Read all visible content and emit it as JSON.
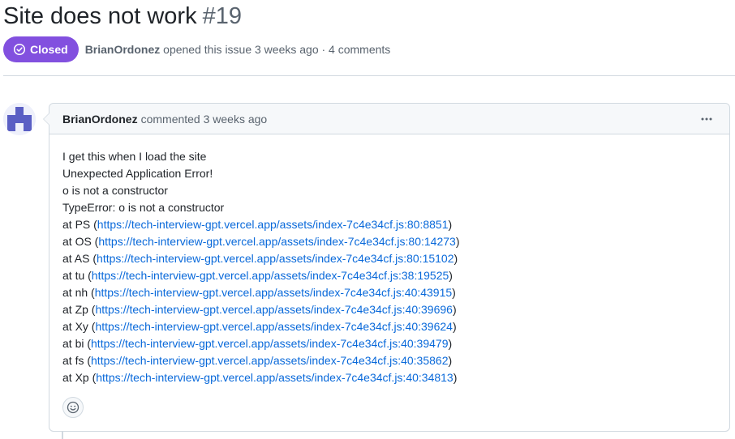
{
  "issue": {
    "title": "Site does not work",
    "number": "#19",
    "state": "Closed",
    "state_color": "#8250df",
    "author": "BrianOrdonez",
    "meta_suffix": "opened this issue 3 weeks ago · 4 comments"
  },
  "comment": {
    "author": "BrianOrdonez",
    "action": "commented 3 weeks ago",
    "menu_icon": "kebab-horizontal-icon",
    "intro_lines": [
      "I get this when I load the site",
      "Unexpected Application Error!",
      "o is not a constructor",
      "TypeError: o is not a constructor"
    ],
    "stack_frames": [
      {
        "prefix": "at PS (",
        "url": "https://tech-interview-gpt.vercel.app/assets/index-7c4e34cf.js:80:8851",
        "suffix": ")"
      },
      {
        "prefix": "at OS (",
        "url": "https://tech-interview-gpt.vercel.app/assets/index-7c4e34cf.js:80:14273",
        "suffix": ")"
      },
      {
        "prefix": "at AS (",
        "url": "https://tech-interview-gpt.vercel.app/assets/index-7c4e34cf.js:80:15102",
        "suffix": ")"
      },
      {
        "prefix": "at tu (",
        "url": "https://tech-interview-gpt.vercel.app/assets/index-7c4e34cf.js:38:19525",
        "suffix": ")"
      },
      {
        "prefix": "at nh (",
        "url": "https://tech-interview-gpt.vercel.app/assets/index-7c4e34cf.js:40:43915",
        "suffix": ")"
      },
      {
        "prefix": "at Zp (",
        "url": "https://tech-interview-gpt.vercel.app/assets/index-7c4e34cf.js:40:39696",
        "suffix": ")"
      },
      {
        "prefix": "at Xy (",
        "url": "https://tech-interview-gpt.vercel.app/assets/index-7c4e34cf.js:40:39624",
        "suffix": ")"
      },
      {
        "prefix": "at bi (",
        "url": "https://tech-interview-gpt.vercel.app/assets/index-7c4e34cf.js:40:39479",
        "suffix": ")"
      },
      {
        "prefix": "at fs (",
        "url": "https://tech-interview-gpt.vercel.app/assets/index-7c4e34cf.js:40:35862",
        "suffix": ")"
      },
      {
        "prefix": "at Xp (",
        "url": "https://tech-interview-gpt.vercel.app/assets/index-7c4e34cf.js:40:34813",
        "suffix": ")"
      }
    ],
    "reaction_icon": "smiley-icon"
  },
  "colors": {
    "link": "#0969da",
    "muted": "#59636e",
    "border": "#d1d9e0",
    "avatar": "#5a5fc4"
  }
}
